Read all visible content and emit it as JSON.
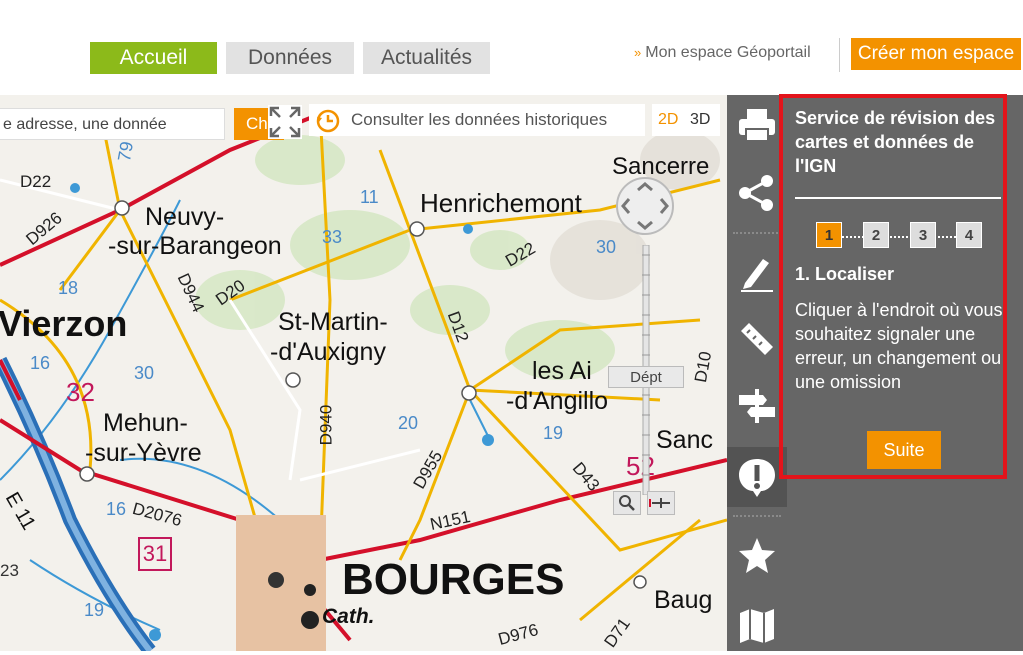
{
  "nav": {
    "tabs": [
      {
        "label": "Accueil",
        "active": true
      },
      {
        "label": "Données",
        "active": false
      },
      {
        "label": "Actualités",
        "active": false
      }
    ],
    "geoportail_link": "Mon espace Géoportail",
    "create_button": "Créer mon espace"
  },
  "map_controls": {
    "search_value": "e adresse, une donnée",
    "search_button": "Ch",
    "history_label": "Consulter les données historiques",
    "mode_2d": "2D",
    "mode_3d": "3D",
    "zoom_scale_label": "Dépt"
  },
  "map_labels": {
    "sancerre": "Sancerre",
    "henrichemont": "Henrichemont",
    "neuvy": "Neuvy-",
    "neuvy2": "-sur-Barangeon",
    "vierzon": "Vierzon",
    "stmartin": "St-Martin-",
    "stmartin2": "-d'Auxigny",
    "lesaix": "les Ai",
    "lesaix2": "-d'Angillo",
    "mehun": "Mehun-",
    "mehun2": "-sur-Yèvre",
    "bourges": "BOURGES",
    "cath": "Cath.",
    "sanc": "Sanc",
    "baug": "Baug",
    "d22a": "D22",
    "d926": "D926",
    "d944": "D944",
    "d20": "D20",
    "d12": "D12",
    "d22b": "D22",
    "d940": "D940",
    "d955": "D955",
    "d43": "D43",
    "n151": "N151",
    "d2076": "D2076",
    "d976": "D976",
    "d71": "D71",
    "d10": "D10",
    "e11": "E 11",
    "r79": "79",
    "r18": "18",
    "r16": "16",
    "r32": "32",
    "r30a": "30",
    "r33": "33",
    "r11": "11",
    "r30b": "30",
    "r20": "20",
    "r19a": "19",
    "r52": "52",
    "r16b": "16",
    "r31": "31",
    "r19b": "19",
    "r23": "23"
  },
  "panel": {
    "title": "Service de révision des cartes et données de l'IGN",
    "steps": [
      "1",
      "2",
      "3",
      "4"
    ],
    "active_step": 1,
    "step_title": "1. Localiser",
    "step_text": "Cliquer à l'endroit où vous souhaitez signaler une erreur, un changement ou une omission",
    "next_button": "Suite"
  },
  "colors": {
    "accent": "#f39200",
    "active_tab": "#8cba1a",
    "panel_bg": "#666666",
    "highlight_frame": "#e3141b"
  }
}
